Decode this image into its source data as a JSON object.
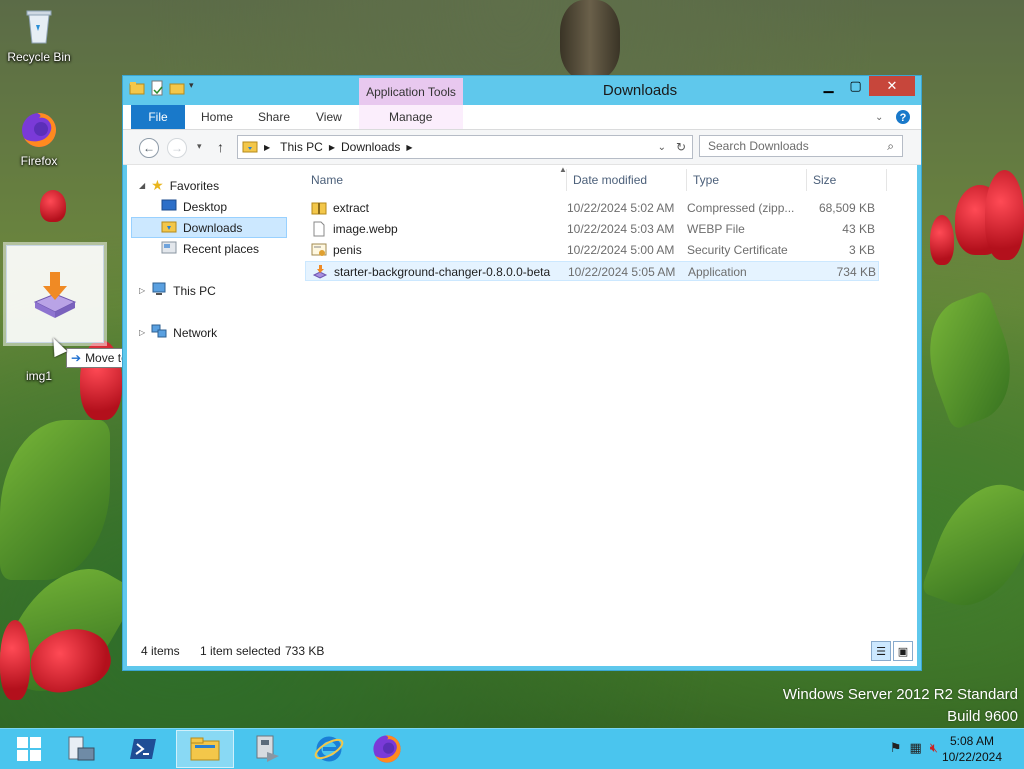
{
  "desktop": {
    "icons": [
      {
        "label": "Recycle Bin"
      },
      {
        "label": "Firefox"
      },
      {
        "label": "img1"
      }
    ],
    "drag_tooltip": "Move to Desktop",
    "watermark_line1": "Windows Server 2012 R2 Standard",
    "watermark_line2": "Build 9600"
  },
  "window": {
    "title": "Downloads",
    "context_tab": "Application Tools",
    "ribbon_tabs": [
      "File",
      "Home",
      "Share",
      "View",
      "Manage"
    ],
    "address": {
      "segments": [
        "This PC",
        "Downloads"
      ]
    },
    "search_placeholder": "Search Downloads",
    "nav": {
      "favorites": "Favorites",
      "desktop": "Desktop",
      "downloads": "Downloads",
      "recent": "Recent places",
      "thispc": "This PC",
      "network": "Network"
    },
    "columns": [
      "Name",
      "Date modified",
      "Type",
      "Size"
    ],
    "files": [
      {
        "name": "extract",
        "date": "10/22/2024 5:02 AM",
        "type": "Compressed (zipp...",
        "size": "68,509 KB"
      },
      {
        "name": "image.webp",
        "date": "10/22/2024 5:03 AM",
        "type": "WEBP File",
        "size": "43 KB"
      },
      {
        "name": "penis",
        "date": "10/22/2024 5:00 AM",
        "type": "Security Certificate",
        "size": "3 KB"
      },
      {
        "name": "starter-background-changer-0.8.0.0-beta",
        "date": "10/22/2024 5:05 AM",
        "type": "Application",
        "size": "734 KB"
      }
    ],
    "status": {
      "count": "4 items",
      "selected": "1 item selected",
      "selected_size": "733 KB"
    }
  },
  "taskbar": {
    "time": "5:08 AM",
    "date": "10/22/2024"
  },
  "colors": {
    "window_frame": "#5fc8ec",
    "file_tab": "#1979ca",
    "close_button": "#c7463b",
    "taskbar": "#4ac5ee"
  }
}
